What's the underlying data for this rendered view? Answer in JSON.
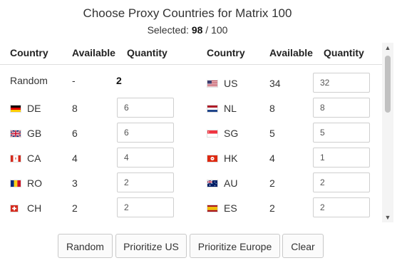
{
  "dialog": {
    "title": "Choose Proxy Countries for Matrix 100",
    "selected_label": "Selected:",
    "selected_count": "98",
    "selected_total": "/ 100"
  },
  "table": {
    "headers": {
      "country": "Country",
      "available": "Available",
      "quantity": "Quantity"
    },
    "random_row": {
      "country": "Random",
      "available": "-",
      "quantity": "2"
    },
    "left": [
      {
        "flag": "flag-de-icon",
        "country": "DE",
        "available": "8",
        "quantity": "6"
      },
      {
        "flag": "flag-gb-icon",
        "country": "GB",
        "available": "6",
        "quantity": "6"
      },
      {
        "flag": "flag-ca-icon",
        "country": "CA",
        "available": "4",
        "quantity": "4"
      },
      {
        "flag": "flag-ro-icon",
        "country": "RO",
        "available": "3",
        "quantity": "2"
      },
      {
        "flag": "flag-ch-icon",
        "country": "CH",
        "available": "2",
        "quantity": "2"
      }
    ],
    "right": [
      {
        "flag": "flag-us-icon",
        "country": "US",
        "available": "34",
        "quantity": "32"
      },
      {
        "flag": "flag-nl-icon",
        "country": "NL",
        "available": "8",
        "quantity": "8"
      },
      {
        "flag": "flag-sg-icon",
        "country": "SG",
        "available": "5",
        "quantity": "5"
      },
      {
        "flag": "flag-hk-icon",
        "country": "HK",
        "available": "4",
        "quantity": "1"
      },
      {
        "flag": "flag-au-icon",
        "country": "AU",
        "available": "2",
        "quantity": "2"
      },
      {
        "flag": "flag-es-icon",
        "country": "ES",
        "available": "2",
        "quantity": "2"
      }
    ]
  },
  "buttons": {
    "random": "Random",
    "prioritize_us": "Prioritize US",
    "prioritize_europe": "Prioritize Europe",
    "clear": "Clear"
  },
  "colors": {
    "border": "#c8c8c8",
    "scroll_thumb": "#c1c1c1"
  }
}
